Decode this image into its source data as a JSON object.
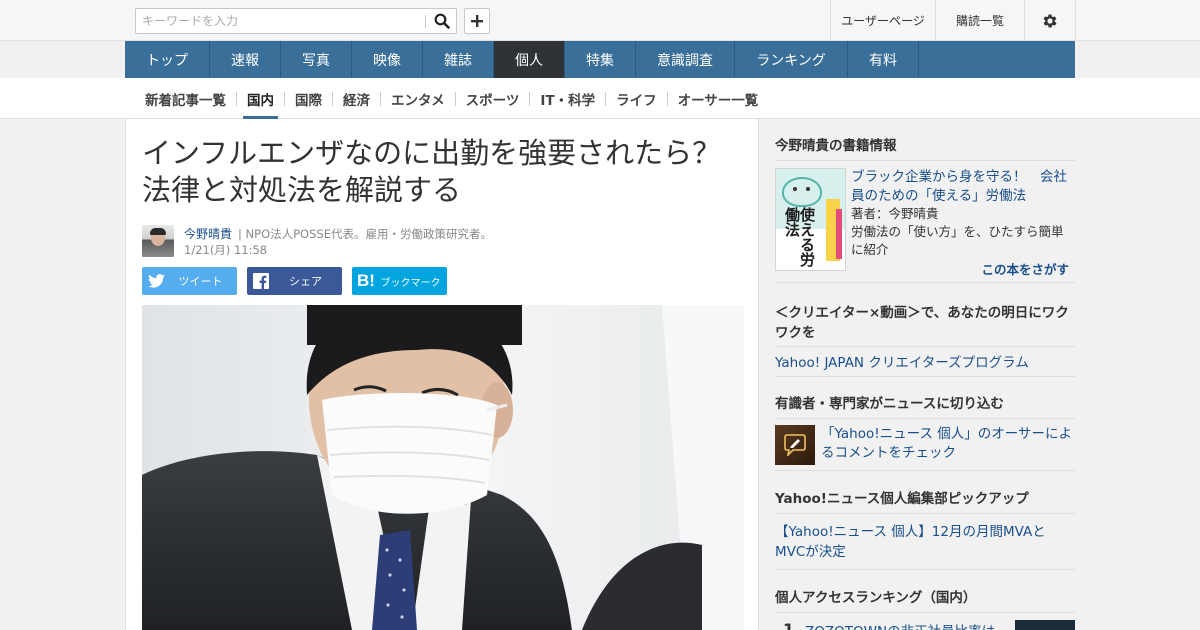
{
  "header": {
    "search_placeholder": "キーワードを入力",
    "user_page": "ユーザーページ",
    "subscriptions": "購読一覧"
  },
  "main_nav": [
    "トップ",
    "速報",
    "写真",
    "映像",
    "雑誌",
    "個人",
    "特集",
    "意識調査",
    "ランキング",
    "有料"
  ],
  "main_nav_active": "個人",
  "sub_nav": [
    "新着記事一覧",
    "国内",
    "国際",
    "経済",
    "エンタメ",
    "スポーツ",
    "IT・科学",
    "ライフ",
    "オーサー一覧"
  ],
  "sub_nav_active": "国内",
  "article": {
    "title": "インフルエンザなのに出勤を強要されたら？　法律と対処法を解説する",
    "author": "今野晴貴",
    "author_desc": "| NPO法人POSSE代表。雇用・労働政策研究者。",
    "date": "1/21(月) 11:58",
    "share": {
      "tweet": "ツイート",
      "share": "シェア",
      "bookmark": "ブックマーク"
    }
  },
  "sidebar": {
    "books": {
      "heading": "今野晴貴の書籍情報",
      "book_title": "ブラック企業から身を守る！　会社員のための「使える」労働法",
      "book_author": "著者：今野晴貴",
      "book_desc": "労働法の「使い方」を、ひたすら簡単に紹介",
      "find_link": "この本をさがす",
      "cover_text": "使える労働法"
    },
    "creators": {
      "heading": "＜クリエイター×動画＞で、あなたの明日にワクワクを",
      "link": "Yahoo! JAPAN クリエイターズプログラム"
    },
    "experts": {
      "heading": "有識者・専門家がニュースに切り込む",
      "link": "「Yahoo!ニュース 個人」のオーサーによるコメントをチェック"
    },
    "pickup": {
      "heading": "Yahoo!ニュース個人編集部ピックアップ",
      "link": "【Yahoo!ニュース 個人】12月の月間MVAとMVCが決定"
    },
    "ranking": {
      "heading": "個人アクセスランキング（国内）",
      "first_rank": "1",
      "first_title": "ZOZOTOWNの非正社員比率は"
    }
  }
}
